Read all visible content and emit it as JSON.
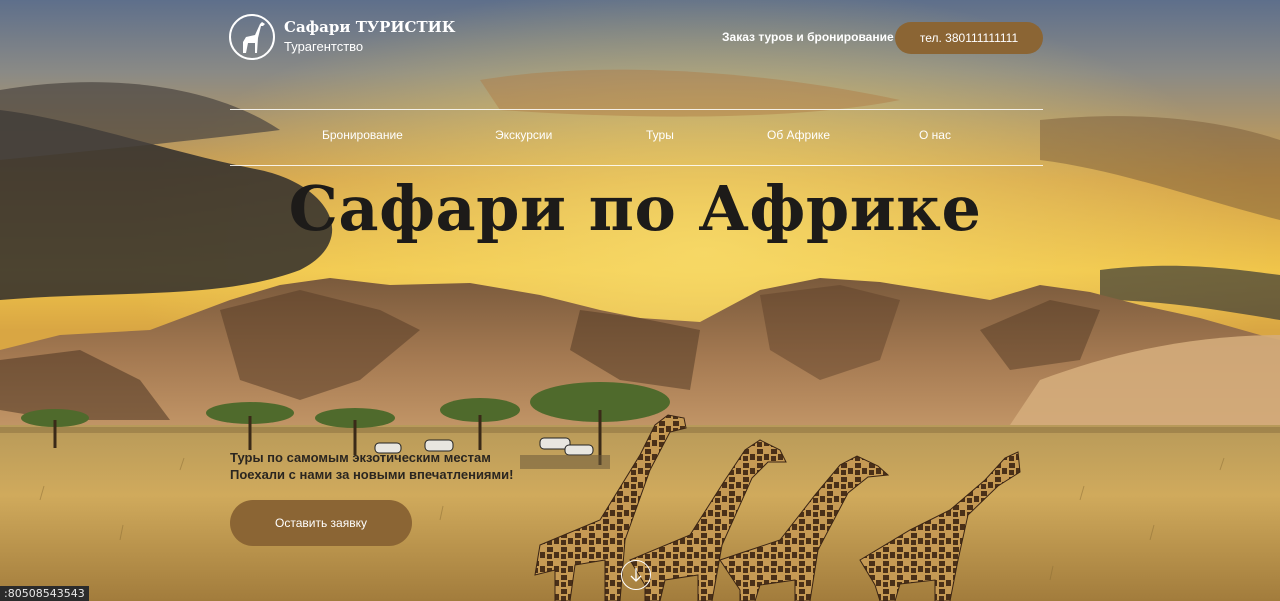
{
  "brand": {
    "name": "Сафари ТУРИСТИК",
    "subtitle": "Турагентство",
    "logo_icon": "giraffe-icon"
  },
  "header": {
    "booking_link": "Заказ туров и бронирование",
    "phone": "тел. 380111111111"
  },
  "nav": {
    "items": [
      {
        "label": "Бронирование"
      },
      {
        "label": "Экскурсии"
      },
      {
        "label": "Туры"
      },
      {
        "label": "Об Африке"
      },
      {
        "label": "О нас"
      }
    ]
  },
  "hero": {
    "title": "Сафари по Африке",
    "tagline_line1": "Туры по самомым экзотическим местам",
    "tagline_line2": "Поехали с нами за новыми впечатлениями!",
    "cta": "Оставить заявку",
    "scroll_icon": "arrow-down-icon"
  },
  "status_bar": {
    "url": ":80508543543"
  },
  "colors": {
    "accent": "#8b6534",
    "title": "#1d1b19",
    "sky_top": "#5d6f8a",
    "sky_glow": "#e8b93c",
    "savanna": "#c9a557"
  }
}
